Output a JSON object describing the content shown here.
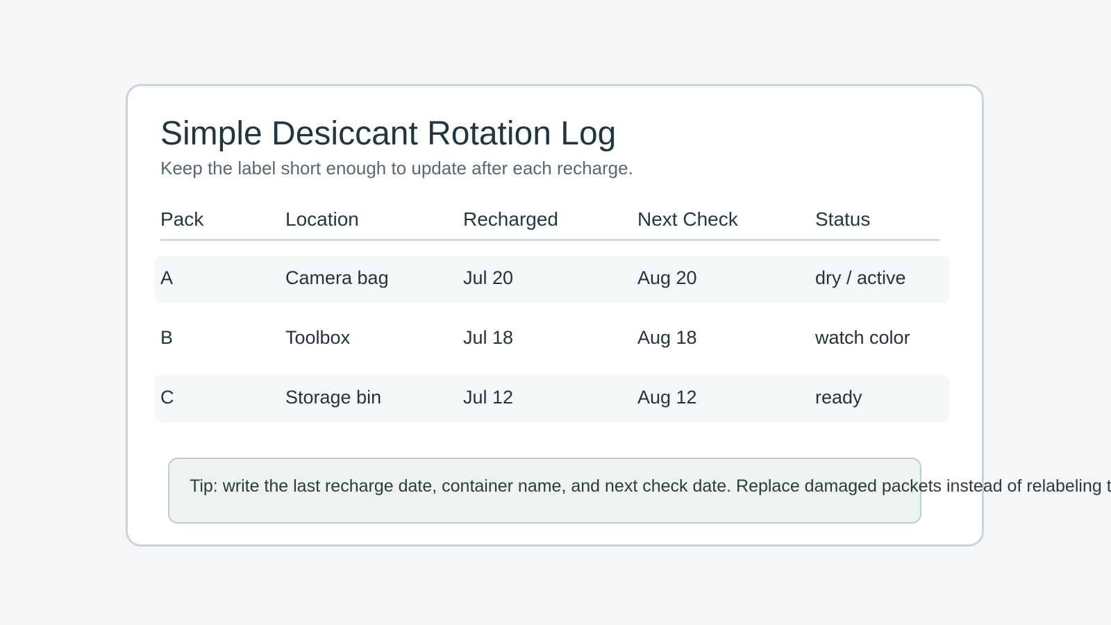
{
  "document": {
    "title": "Simple Desiccant Rotation Log",
    "subtitle": "Keep the label short enough to update after each recharge."
  },
  "table": {
    "columns": [
      "Pack",
      "Location",
      "Recharged",
      "Next Check",
      "Status"
    ],
    "rows": [
      [
        "A",
        "Camera bag",
        "Jul 20",
        "Aug 20",
        "dry / active"
      ],
      [
        "B",
        "Toolbox",
        "Jul 18",
        "Aug 18",
        "watch color"
      ],
      [
        "C",
        "Storage bin",
        "Jul 12",
        "Aug 12",
        "ready"
      ]
    ]
  },
  "tip": {
    "text": "Tip: write the last recharge date, container name, and next check date. Replace damaged packets instead of relabeling them."
  },
  "colors": {
    "background": "#f4f6f7",
    "card": "#ffffff",
    "tip_background": "#edf3ef",
    "tip_border": "#b9d1c6",
    "row_shade": "#f4f8f8"
  }
}
